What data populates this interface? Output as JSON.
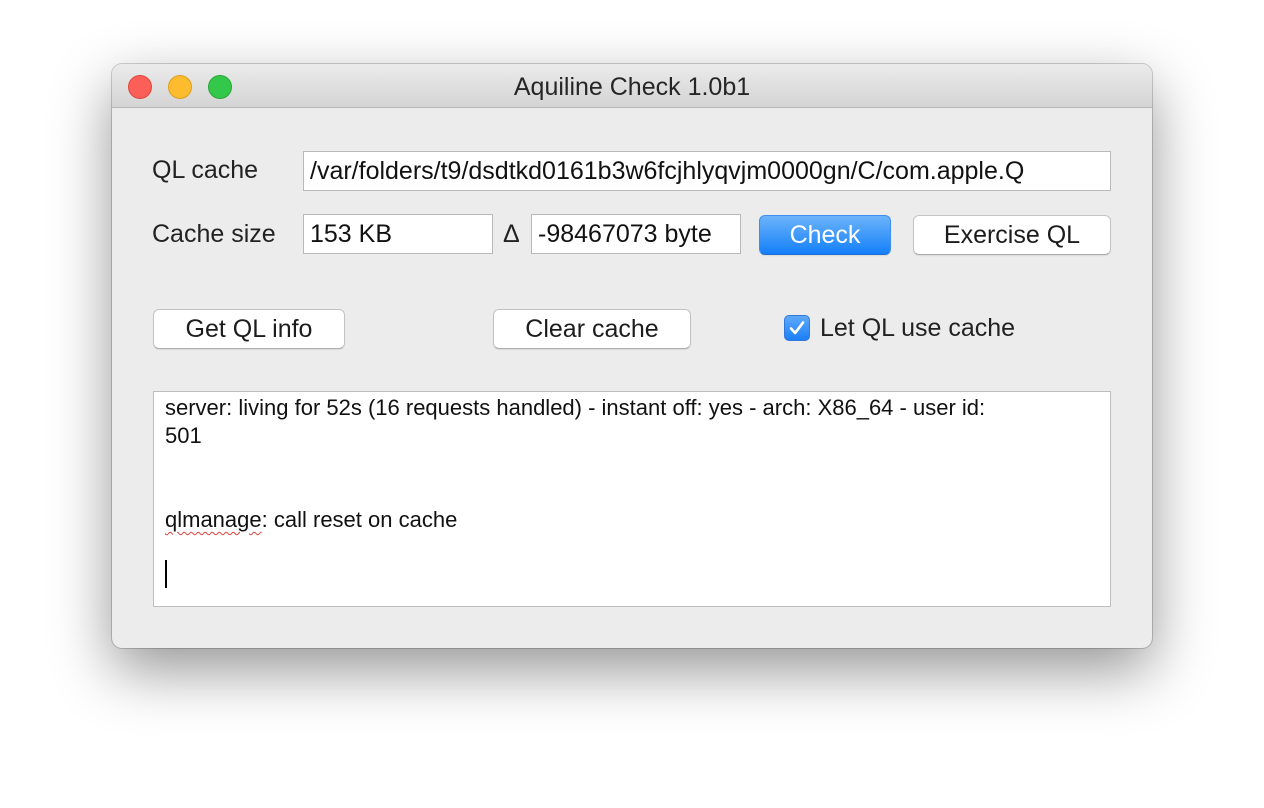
{
  "window": {
    "title": "Aquiline Check 1.0b1"
  },
  "ql_cache": {
    "label": "QL cache",
    "path": "/var/folders/t9/dsdtkd0161b3w6fcjhlyqvjm0000gn/C/com.apple.Q"
  },
  "cache_size": {
    "label": "Cache size",
    "value": "153 KB",
    "delta_symbol": "Δ",
    "delta_value": "-98467073 byte"
  },
  "buttons": {
    "check": "Check",
    "exercise": "Exercise QL",
    "get_info": "Get QL info",
    "clear_cache": "Clear cache"
  },
  "option": {
    "label": "Let QL use cache",
    "checked": true
  },
  "log": {
    "line1": "server: living for 52s (16 requests handled) - instant off: yes - arch: X86_64 - user id:",
    "line2": "501",
    "line3_word": "qlmanage",
    "line3_rest": ": call reset on cache"
  },
  "colors": {
    "accent": "#1480f9",
    "close": "#fc5f57",
    "minimize": "#fdbc2e",
    "zoom": "#34c84a"
  }
}
